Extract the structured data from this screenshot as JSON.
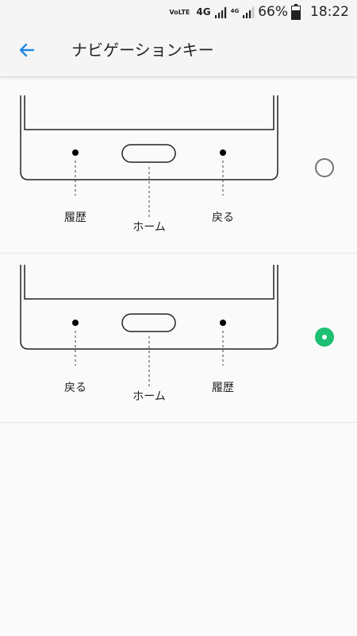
{
  "status_bar": {
    "volte": "VoLTE",
    "net1": "4G",
    "net2": "4G",
    "battery": "66%",
    "time": "18:22"
  },
  "toolbar": {
    "title": "ナビゲーションキー"
  },
  "options": [
    {
      "left_label": "履歴",
      "center_label": "ホーム",
      "right_label": "戻る",
      "selected": false
    },
    {
      "left_label": "戻る",
      "center_label": "ホーム",
      "right_label": "履歴",
      "selected": true
    }
  ],
  "colors": {
    "accent": "#1dbf73",
    "back_arrow": "#1e88e5",
    "radio_off": "#757575"
  }
}
